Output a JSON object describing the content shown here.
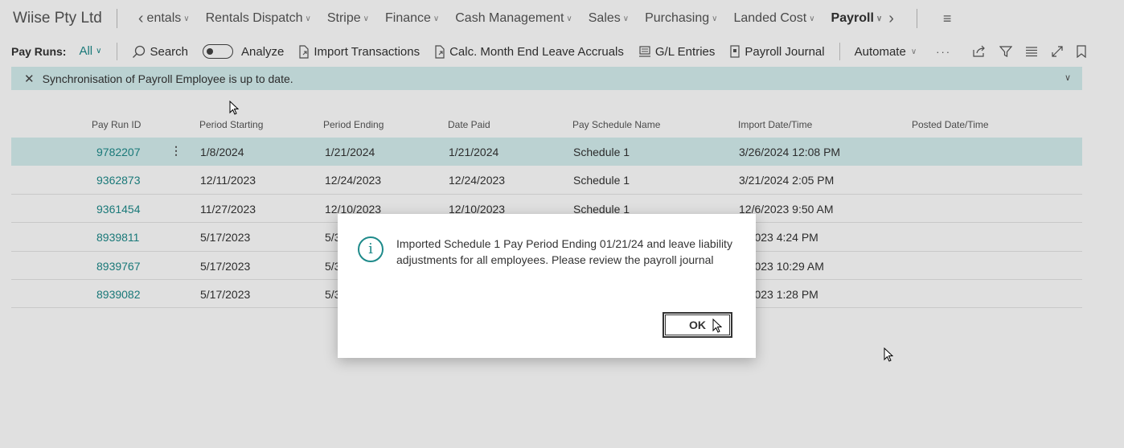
{
  "app": {
    "company": "Wiise Pty Ltd"
  },
  "nav": {
    "items": [
      {
        "label": "entals",
        "has_chevron": true
      },
      {
        "label": "Rentals Dispatch",
        "has_chevron": true
      },
      {
        "label": "Stripe",
        "has_chevron": true
      },
      {
        "label": "Finance",
        "has_chevron": true
      },
      {
        "label": "Cash Management",
        "has_chevron": true
      },
      {
        "label": "Sales",
        "has_chevron": true
      },
      {
        "label": "Purchasing",
        "has_chevron": true
      },
      {
        "label": "Landed Cost",
        "has_chevron": true
      },
      {
        "label": "Payroll",
        "has_chevron": true,
        "active": true
      }
    ]
  },
  "actionbar": {
    "title": "Pay Runs:",
    "filter": "All",
    "search": "Search",
    "analyze": "Analyze",
    "import_transactions": "Import Transactions",
    "calc_leave": "Calc. Month End Leave Accruals",
    "gl_entries": "G/L Entries",
    "payroll_journal": "Payroll Journal",
    "automate": "Automate",
    "more": "···"
  },
  "notification": {
    "text": "Synchronisation of Payroll Employee is up to date."
  },
  "table": {
    "columns": [
      "Pay Run ID",
      "Period Starting",
      "Period Ending",
      "Date Paid",
      "Pay Schedule Name",
      "Import Date/Time",
      "Posted Date/Time"
    ],
    "rows": [
      [
        "9782207",
        "1/8/2024",
        "1/21/2024",
        "1/21/2024",
        "Schedule 1",
        "3/26/2024 12:08 PM",
        ""
      ],
      [
        "9362873",
        "12/11/2023",
        "12/24/2023",
        "12/24/2023",
        "Schedule 1",
        "3/21/2024 2:05 PM",
        ""
      ],
      [
        "9361454",
        "11/27/2023",
        "12/10/2023",
        "12/10/2023",
        "Schedule 1",
        "12/6/2023 9:50 AM",
        ""
      ],
      [
        "8939811",
        "5/17/2023",
        "5/3",
        "",
        "",
        "0/2023 4:24 PM",
        ""
      ],
      [
        "8939767",
        "5/17/2023",
        "5/3",
        "",
        "",
        "0/2023 10:29 AM",
        ""
      ],
      [
        "8939082",
        "5/17/2023",
        "5/3",
        "",
        "",
        "0/2023 1:28 PM",
        ""
      ]
    ]
  },
  "dialog": {
    "message": "Imported Schedule 1 Pay Period Ending 01/21/24 and leave liability adjustments for all employees. Please review the payroll journal",
    "ok_label": "OK",
    "icon_glyph": "i"
  },
  "colors": {
    "accent": "#1e8a8a",
    "selected_row": "#d5eff0",
    "notification": "#d5eff0"
  }
}
